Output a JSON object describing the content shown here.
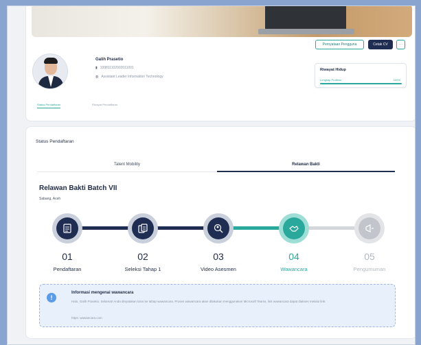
{
  "profile": {
    "name": "Galih Prasetio",
    "id_number": "199811102002011001",
    "position": "Assistant Leader Information Technology",
    "buttons": {
      "statement": "Pernyataan Pengguna",
      "cv": "Cetak CV",
      "more": "···"
    },
    "riwayat": {
      "title": "Riwayat Hidup",
      "label": "Lengkap Profilmu",
      "percent_text": "100%",
      "progress": 1.0
    },
    "tabs": [
      "Status Pendaftaran",
      "Riwayat Pendaftaran"
    ]
  },
  "status": {
    "title": "Status Pendaftaran",
    "tabs": [
      "Talent Mobility",
      "Relawan Bakti"
    ],
    "active_tab": "Relawan Bakti",
    "batch_title": "Relawan Bakti Batch VII",
    "location": "Sabang, Aceh",
    "steps": [
      {
        "num": "01",
        "label": "Pendaftaran",
        "state": "done",
        "icon": "form-icon"
      },
      {
        "num": "02",
        "label": "Seleksi Tahap 1",
        "state": "done",
        "icon": "documents-icon"
      },
      {
        "num": "03",
        "label": "Video Asesmen",
        "state": "done",
        "icon": "video-search-icon"
      },
      {
        "num": "04",
        "label": "Wawancara",
        "state": "current",
        "icon": "handshake-icon"
      },
      {
        "num": "05",
        "label": "Pengumuman",
        "state": "pending",
        "icon": "announcement-icon"
      }
    ],
    "info": {
      "title": "Informasi mengenai wawancara",
      "text": "Halo, Galih Prasetio. Selamat! Anda dinyatakan lolos ke tahap wawancara. Proses wawancara akan dilakukan menggunakan Microsoft Teams, link wawancara dapat diakses melalui link:",
      "link": "https: wawancara.com"
    }
  },
  "colors": {
    "navy": "#1f2d52",
    "teal": "#2aa89c",
    "grey": "#c7cbd1",
    "info_bg": "#e8f0fb"
  }
}
